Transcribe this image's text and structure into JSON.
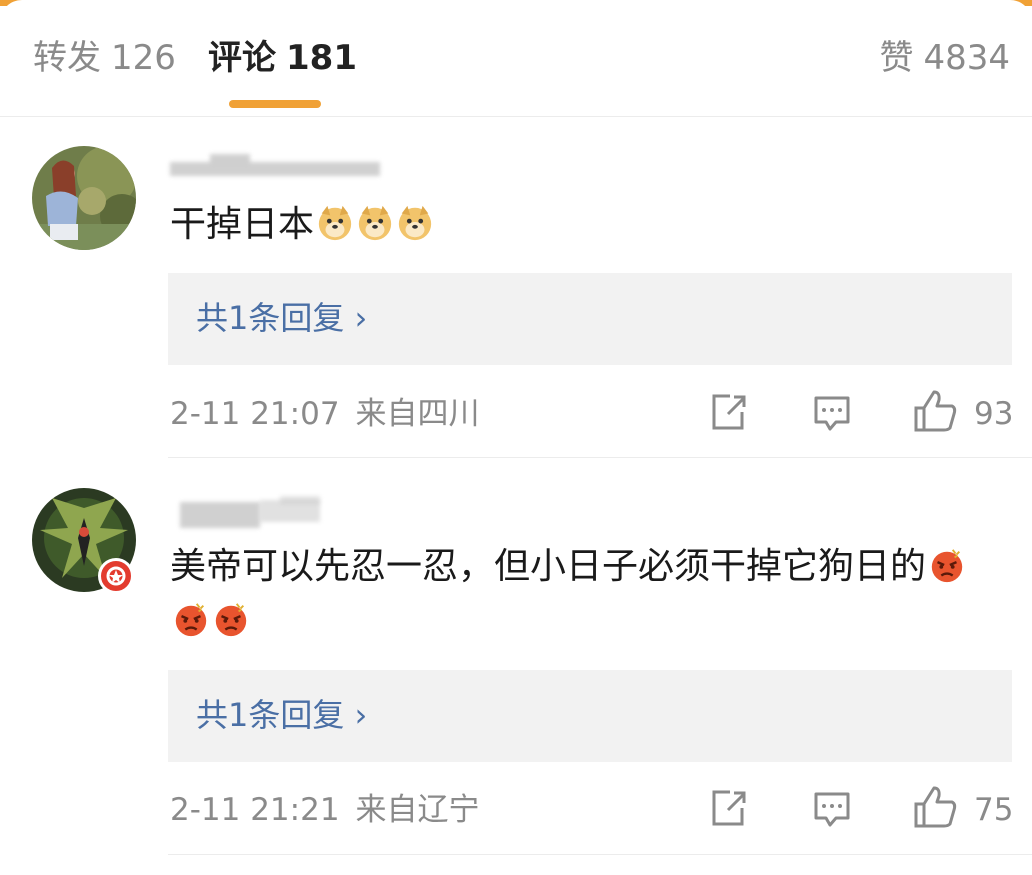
{
  "tabs": {
    "repost": {
      "label": "转发",
      "count": "126"
    },
    "comment": {
      "label": "评论",
      "count": "181"
    },
    "like": {
      "label": "赞",
      "count": "4834"
    }
  },
  "comments": [
    {
      "text": "干掉日本",
      "emoji": [
        "doge-emoji",
        "doge-emoji",
        "doge-emoji"
      ],
      "replies_label": "共1条回复 ›",
      "time": "2-11 21:07",
      "location": "来自四川",
      "likes": "93"
    },
    {
      "text": "美帝可以先忍一忍，但小日子必须干掉它狗日的",
      "emoji": [
        "angry-emoji",
        "angry-emoji",
        "angry-emoji"
      ],
      "replies_label": "共1条回复 ›",
      "time": "2-11 21:21",
      "location": "来自辽宁",
      "likes": "75"
    }
  ],
  "colors": {
    "accent": "#f0a136",
    "link": "#4a6fa5",
    "muted": "#8a8a8a",
    "reply_bg": "#f2f2f2"
  }
}
